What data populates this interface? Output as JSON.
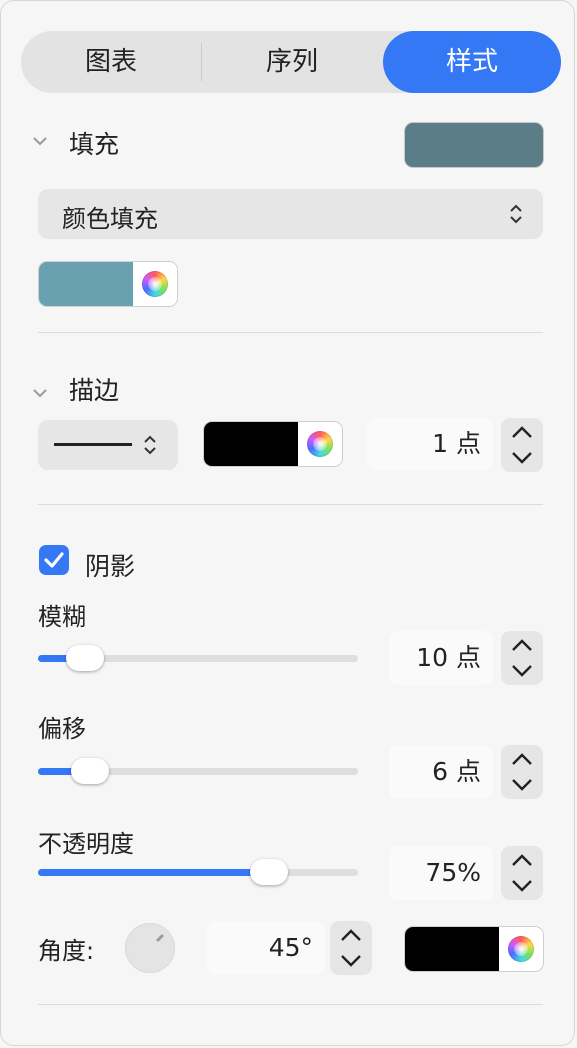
{
  "tabs": [
    {
      "label": "图表"
    },
    {
      "label": "序列"
    },
    {
      "label": "样式",
      "active": true
    }
  ],
  "fill": {
    "title": "填充",
    "swatch_color": "#5a7d87",
    "type_select": "颜色填充",
    "color_well_color": "#6aa1b1"
  },
  "stroke": {
    "title": "描边",
    "line_style": "solid",
    "color": "#000000",
    "width_value": "1 点"
  },
  "shadow": {
    "checked": true,
    "title": "阴影",
    "blur": {
      "label": "模糊",
      "value_text": "10 点",
      "slider_fraction": 0.15
    },
    "offset": {
      "label": "偏移",
      "value_text": "6 点",
      "slider_fraction": 0.16
    },
    "opacity": {
      "label": "不透明度",
      "value_text": "75%",
      "slider_fraction": 0.72
    },
    "angle": {
      "label": "角度:",
      "value_text": "45°"
    },
    "color": "#000000"
  },
  "colors": {
    "accent": "#3478f6"
  },
  "icons": {
    "collapse": "chevron-down-icon",
    "select_arrows": "updown-chevron-icon",
    "color_wheel": "color-wheel-icon",
    "checkmark": "checkmark-icon",
    "stepper": "stepper-arrows-icon"
  }
}
